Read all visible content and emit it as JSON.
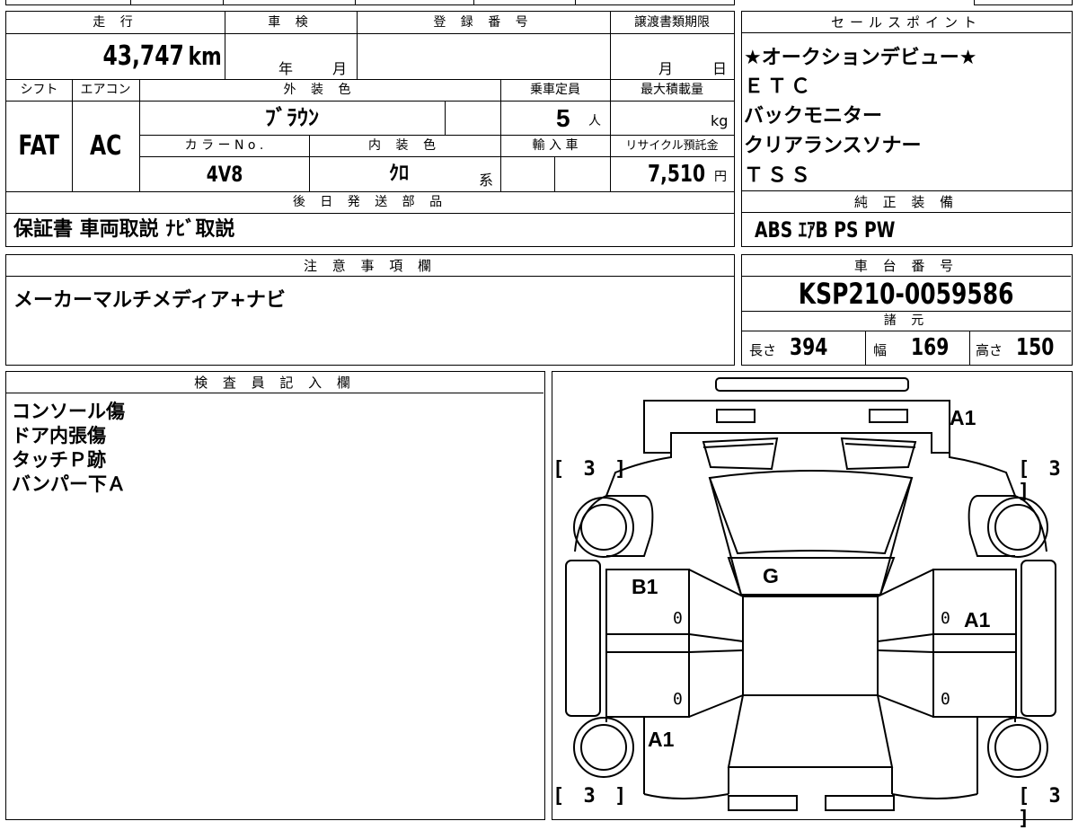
{
  "vehicle": {
    "labels": {
      "mileage": "走 行",
      "inspection": "車 検",
      "registration": "登 録 番 号",
      "transfer_deadline": "譲渡書類期限",
      "shift": "シフト",
      "aircon": "エアコン",
      "exterior_color": "外 装 色",
      "capacity": "乗車定員",
      "max_load": "最大積載量",
      "color_no": "カ ラ ー N o .",
      "interior_color": "内 装 色",
      "import": "輸 入 車",
      "recycle": "リサイクル預託金",
      "later_parts": "後 日 発 送 部 品"
    },
    "mileage": "43,747",
    "mileage_unit": "km",
    "inspection_year_unit": "年",
    "inspection_month_unit": "月",
    "deadline_month_unit": "月",
    "deadline_day_unit": "日",
    "shift": "FAT",
    "aircon": "AC",
    "exterior_color": "ﾌﾞﾗｳﾝ",
    "capacity": "5",
    "capacity_unit": "人",
    "max_load_unit": "kg",
    "color_no": "4V8",
    "interior_color": "ｸﾛ",
    "interior_suffix": "系",
    "recycle_fee": "7,510",
    "recycle_unit": "円",
    "later_parts": "保証書 車両取説 ﾅﾋﾞ取説"
  },
  "sales_points": {
    "header": "セールスポイント",
    "items": [
      "★オークションデビュー★",
      "ＥＴＣ",
      "バックモニター",
      "クリアランスソナー",
      "ＴＳＳ"
    ]
  },
  "standard_equipment": {
    "header": "純 正 装 備",
    "value": "ABS ｴｱB PS PW"
  },
  "notes": {
    "header": "注 意 事 項 欄",
    "text": "メーカーマルチメディア+ナビ"
  },
  "chassis": {
    "header": "車 台 番 号",
    "value": "KSP210-0059586"
  },
  "specs": {
    "header": "諸 元",
    "length_label": "長さ",
    "length": "394",
    "width_label": "幅",
    "width": "169",
    "height_label": "高さ",
    "height": "150"
  },
  "inspector": {
    "header": "検 査 員 記 入 欄",
    "lines": [
      "コンソール傷",
      "ドア内張傷",
      "タッチＰ跡",
      "バンパー下Ａ"
    ]
  },
  "diagram": {
    "marks": {
      "rear_bumper": "A1",
      "roof_glass": "G",
      "left_front_door": "B1",
      "right_front_door": "A1",
      "left_front_fender": "A1"
    },
    "tire_values": [
      "[ 3 ]",
      "[ 3 ]",
      "[ 3 ]",
      "[ 3 ]"
    ],
    "door_values": [
      "0",
      "0",
      "0",
      "0"
    ]
  }
}
